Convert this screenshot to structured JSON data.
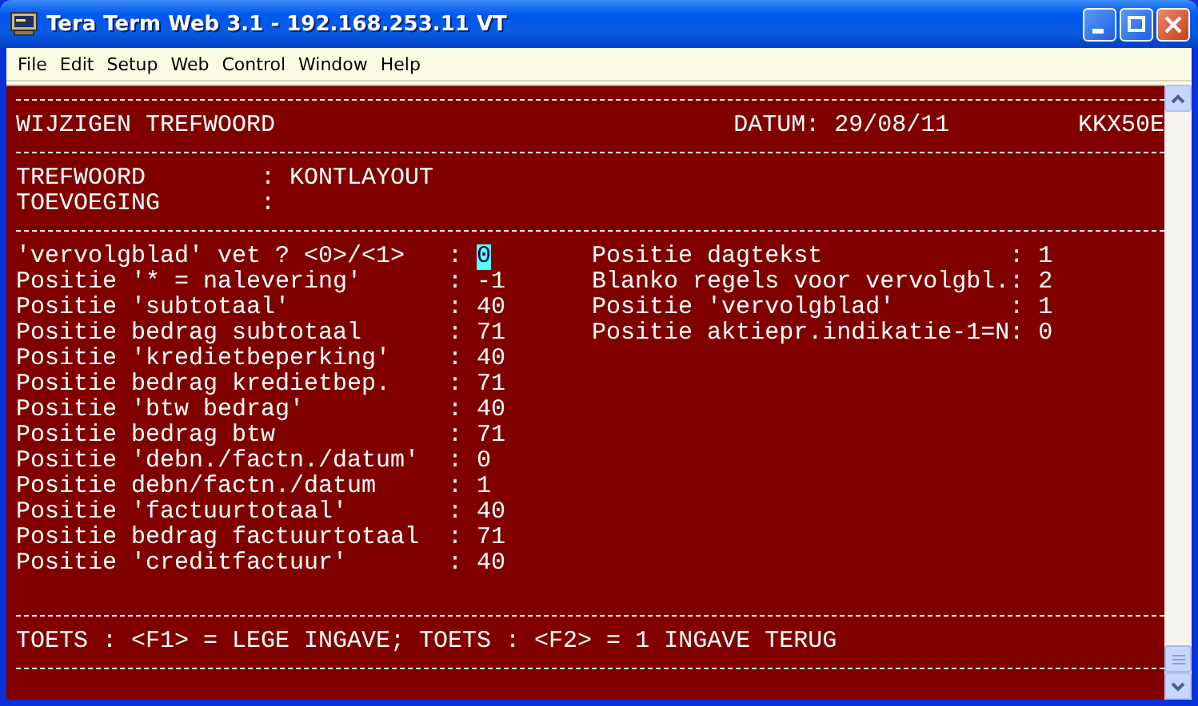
{
  "window": {
    "title": "Tera Term Web 3.1 - 192.168.253.11 VT"
  },
  "menu": [
    {
      "label": "File"
    },
    {
      "label": "Edit"
    },
    {
      "label": "Setup"
    },
    {
      "label": "Web"
    },
    {
      "label": "Control"
    },
    {
      "label": "Window"
    },
    {
      "label": "Help"
    }
  ],
  "terminal": {
    "header": {
      "title": "WIJZIGEN TREFWOORD",
      "date": "DATUM: 29/08/11",
      "program": "KKX50E"
    },
    "keys": [
      {
        "label": "TREFWOORD",
        "separator": ":",
        "value": "KONTLAYOUT"
      },
      {
        "label": "TOEVOEGING",
        "separator": ":"
      }
    ],
    "left_fields": [
      {
        "label": "'vervolgblad' vet ? <0>/<1>",
        "separator": ":",
        "value": "0",
        "cursor": true
      },
      {
        "label": "Positie '* = nalevering'",
        "separator": ":",
        "value": "-1",
        "cursor": false
      },
      {
        "label": "Positie 'subtotaal'",
        "separator": ":",
        "value": "40",
        "cursor": false
      },
      {
        "label": "Positie bedrag subtotaal",
        "separator": ":",
        "value": "71",
        "cursor": false
      },
      {
        "label": "Positie 'kredietbeperking'",
        "separator": ":",
        "value": "40",
        "cursor": false
      },
      {
        "label": "Positie bedrag kredietbep.",
        "separator": ":",
        "value": "71",
        "cursor": false
      },
      {
        "label": "Positie 'btw bedrag'",
        "separator": ":",
        "value": "40",
        "cursor": false
      },
      {
        "label": "Positie bedrag btw",
        "separator": ":",
        "value": "71",
        "cursor": false
      },
      {
        "label": "Positie 'debn./factn./datum'",
        "separator": ":",
        "value": "0",
        "cursor": false
      },
      {
        "label": "Positie debn/factn./datum",
        "separator": ":",
        "value": "1",
        "cursor": false
      },
      {
        "label": "Positie 'factuurtotaal'",
        "separator": ":",
        "value": "40",
        "cursor": false
      },
      {
        "label": "Positie bedrag factuurtotaal",
        "separator": ":",
        "value": "71",
        "cursor": false
      },
      {
        "label": "Positie 'creditfactuur'",
        "separator": ":",
        "value": "40",
        "cursor": false
      }
    ],
    "right_fields": [
      {
        "label": "Positie dagtekst",
        "separator": ":",
        "value": "1"
      },
      {
        "label": "Blanko regels voor vervolgbl.",
        "separator": ":",
        "value": "2"
      },
      {
        "label": "Positie 'vervolgblad'",
        "separator": ":",
        "value": "1"
      },
      {
        "label": "Positie aktiepr.indikatie-1=N",
        "separator": ":",
        "value": "0"
      }
    ],
    "footer": "TOETS : <F1> = LEGE INGAVE; TOETS : <F2> = 1 INGAVE TERUG"
  }
}
